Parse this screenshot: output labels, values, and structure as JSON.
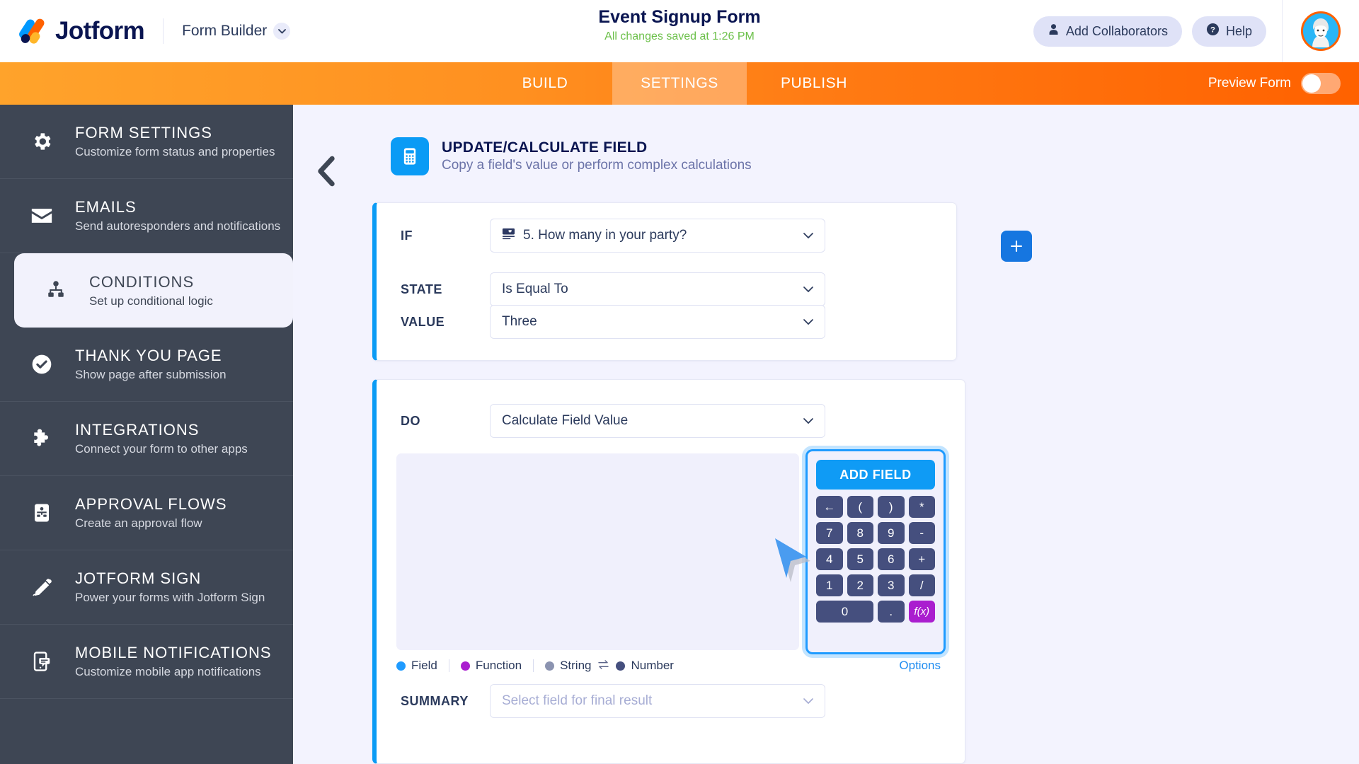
{
  "header": {
    "brand_name": "Jotform",
    "brand_logo_icon": "jotform-logo-icon",
    "form_builder_label": "Form Builder",
    "form_builder_caret_icon": "chevron-down-icon",
    "form_title": "Event Signup Form",
    "save_status": "All changes saved at 1:26 PM",
    "add_collaborators_label": "Add Collaborators",
    "add_collaborators_icon": "person-icon",
    "help_label": "Help",
    "help_icon": "question-circle-icon",
    "avatar_icon": "user-avatar",
    "colors": {
      "brand_navy": "#0a1551",
      "saved_green": "#6cc04a",
      "pill_bg": "#dfe2f7",
      "avatar_ring": "#ff6100"
    }
  },
  "tabbar": {
    "tabs": [
      {
        "label": "BUILD",
        "active": false
      },
      {
        "label": "SETTINGS",
        "active": true
      },
      {
        "label": "PUBLISH",
        "active": false
      }
    ],
    "preview_label": "Preview Form",
    "preview_toggle_state": "off",
    "colors": {
      "gradient_start": "#ffa32b",
      "gradient_end": "#ff6100"
    }
  },
  "sidebar": {
    "items": [
      {
        "title": "FORM SETTINGS",
        "subtitle": "Customize form status and properties",
        "icon": "gear-icon",
        "active": false
      },
      {
        "title": "EMAILS",
        "subtitle": "Send autoresponders and notifications",
        "icon": "envelope-icon",
        "active": false
      },
      {
        "title": "CONDITIONS",
        "subtitle": "Set up conditional logic",
        "icon": "sitemap-icon",
        "active": true
      },
      {
        "title": "THANK YOU PAGE",
        "subtitle": "Show page after submission",
        "icon": "check-circle-icon",
        "active": false
      },
      {
        "title": "INTEGRATIONS",
        "subtitle": "Connect your form to other apps",
        "icon": "puzzle-piece-icon",
        "active": false
      },
      {
        "title": "APPROVAL FLOWS",
        "subtitle": "Create an approval flow",
        "icon": "approval-flow-icon",
        "active": false
      },
      {
        "title": "JOTFORM SIGN",
        "subtitle": "Power your forms with Jotform Sign",
        "icon": "pen-icon",
        "active": false
      },
      {
        "title": "MOBILE NOTIFICATIONS",
        "subtitle": "Customize mobile app notifications",
        "icon": "mobile-icon",
        "active": false
      }
    ],
    "colors": {
      "bg": "#3e4654",
      "active_bg": "#f2f2fc"
    }
  },
  "main": {
    "back_arrow_icon": "chevron-left-icon",
    "panel": {
      "icon": "calculator-icon",
      "title": "UPDATE/CALCULATE FIELD",
      "subtitle": "Copy a field's value or perform complex calculations"
    },
    "condition_card": {
      "if_label": "IF",
      "if_value": "5. How many in your party?",
      "if_field_icon": "form-field-icon",
      "state_label": "STATE",
      "state_value": "Is Equal To",
      "value_label": "VALUE",
      "value_value": "Three",
      "add_condition_label": "+",
      "caret_icon": "chevron-down-icon"
    },
    "action_card": {
      "do_label": "DO",
      "do_value": "Calculate Field Value",
      "expression_value": "",
      "add_field_label": "ADD FIELD",
      "keypad": [
        "←",
        "(",
        ")",
        "*",
        "7",
        "8",
        "9",
        "-",
        "4",
        "5",
        "6",
        "+",
        "1",
        "2",
        "3",
        "/",
        "0",
        ".",
        "f(x)"
      ],
      "legend": [
        {
          "label": "Field",
          "color": "#1f9bff"
        },
        {
          "label": "Function",
          "color": "#aa1ecf"
        },
        {
          "label": "String",
          "color": "#8b93b0"
        },
        {
          "label": "Number",
          "color": "#454f7e"
        }
      ],
      "legend_swap_icon": "swap-arrows-icon",
      "options_link": "Options",
      "summary_label": "SUMMARY",
      "summary_placeholder": "Select field for final result",
      "caret_icon": "chevron-down-icon"
    }
  },
  "cursor": {
    "icon": "mouse-pointer-icon",
    "color": "#4a9cf0"
  }
}
